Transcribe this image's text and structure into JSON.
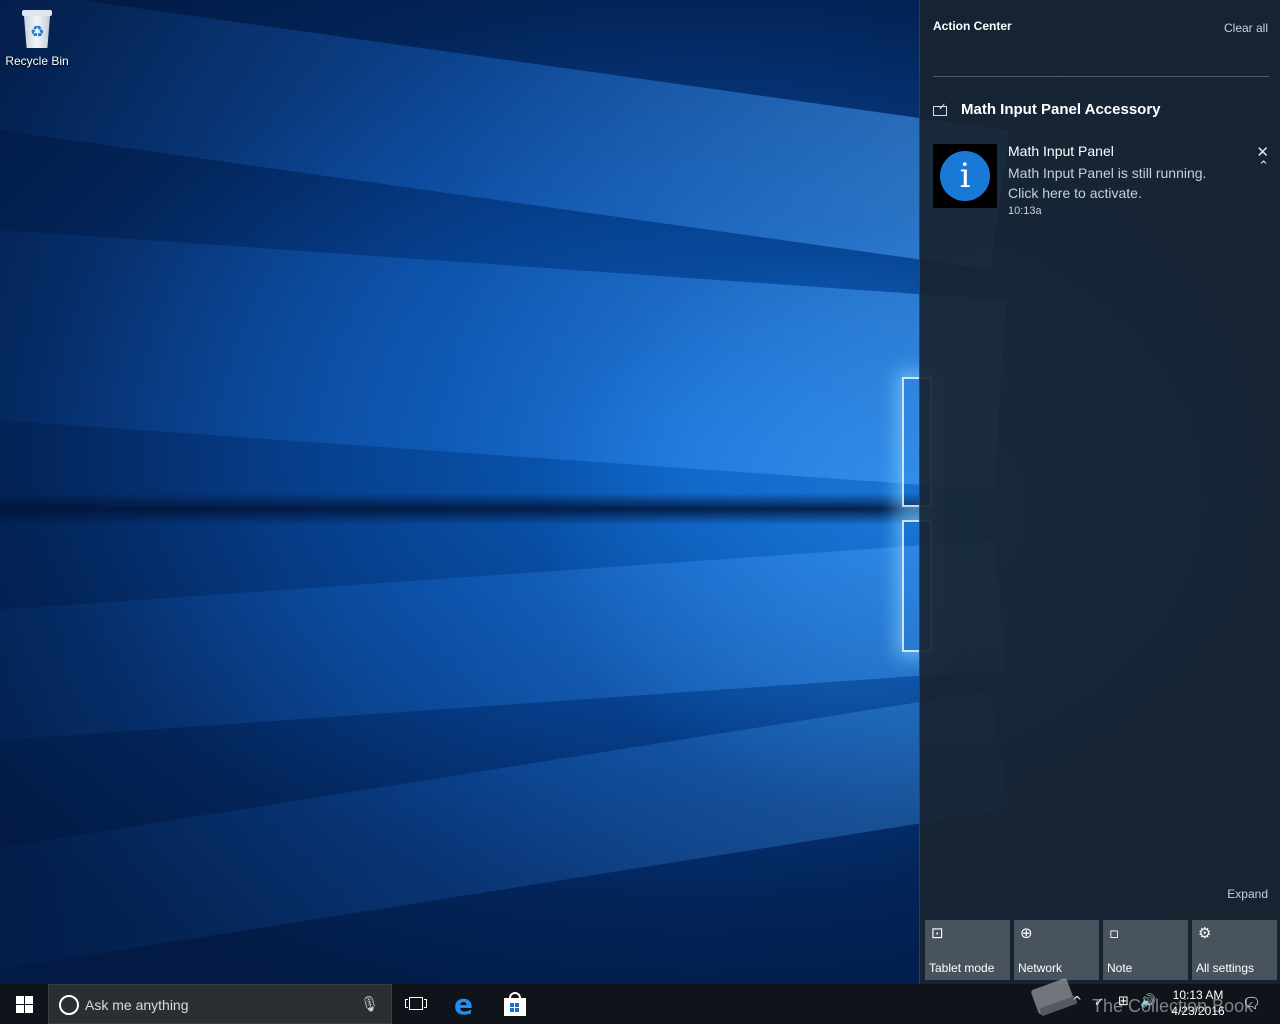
{
  "desktop": {
    "icons": [
      {
        "label": "Recycle Bin",
        "icon": "recycle-bin-icon"
      }
    ]
  },
  "action_center": {
    "title": "Action Center",
    "clear_all": "Clear all",
    "group": {
      "title": "Math Input Panel Accessory",
      "icon": "math-input-panel-icon"
    },
    "notification": {
      "title": "Math Input Panel",
      "body": "Math Input Panel is still running. Click here to activate.",
      "time": "10:13a",
      "image_glyph": "i",
      "close_glyph": "✕",
      "collapse_glyph": "⌃"
    },
    "expand": "Expand",
    "quick_actions": [
      {
        "label": "Tablet mode",
        "icon": "tablet-mode-icon",
        "glyph": "⊡"
      },
      {
        "label": "Network",
        "icon": "network-icon",
        "glyph": "⊕"
      },
      {
        "label": "Note",
        "icon": "note-icon",
        "glyph": "▫"
      },
      {
        "label": "All settings",
        "icon": "gear-icon",
        "glyph": "⚙"
      }
    ]
  },
  "taskbar": {
    "search_placeholder": "Ask me anything",
    "mic_glyph": "🎙",
    "edge_glyph": "e",
    "tray": {
      "chevron_glyph": "^",
      "network_glyph": "⊞",
      "volume_glyph": "🔊",
      "time": "10:13 AM",
      "date": "4/23/2016",
      "notification_glyph": "🗨"
    }
  },
  "watermark": {
    "text": "The Collection Book"
  },
  "colors": {
    "accent": "#1979d6",
    "action_center_bg": "#182430",
    "taskbar_bg": "#0f141a"
  }
}
